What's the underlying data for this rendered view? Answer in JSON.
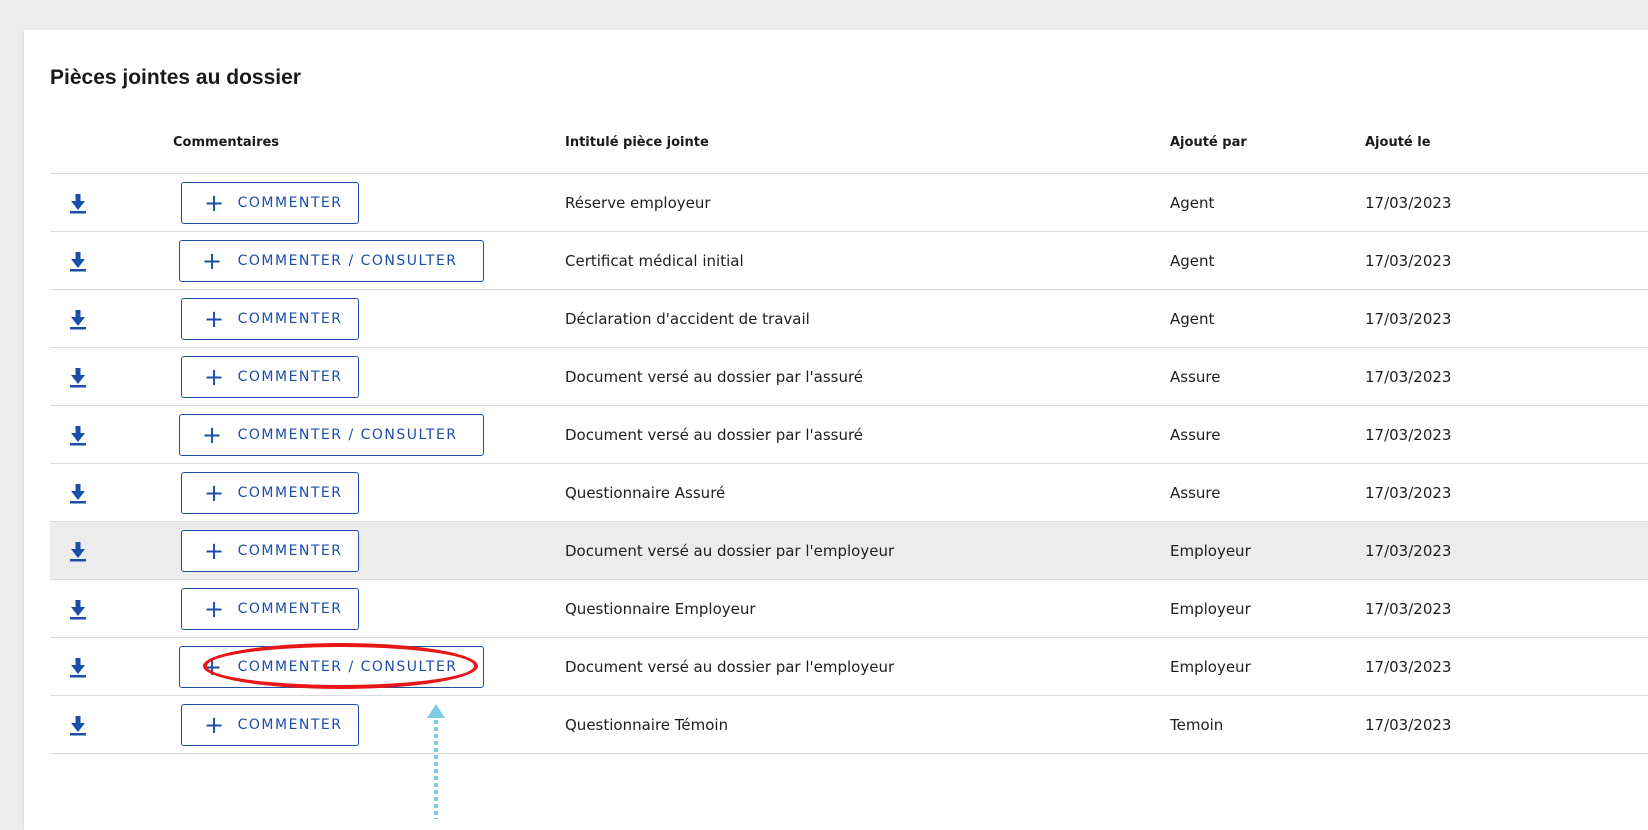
{
  "section": {
    "title": "Pièces jointes au dossier"
  },
  "table": {
    "headers": {
      "comments": "Commentaires",
      "attachment_title": "Intitulé pièce jointe",
      "added_by": "Ajouté par",
      "added_on": "Ajouté le"
    },
    "rows": [
      {
        "button": "COMMENTER",
        "title": "Réserve employeur",
        "added_by": "Agent",
        "date": "17/03/2023"
      },
      {
        "button": "COMMENTER / CONSULTER",
        "title": "Certificat médical initial",
        "added_by": "Agent",
        "date": "17/03/2023"
      },
      {
        "button": "COMMENTER",
        "title": "Déclaration d'accident de travail",
        "added_by": "Agent",
        "date": "17/03/2023"
      },
      {
        "button": "COMMENTER",
        "title": "Document versé au dossier par l'assuré",
        "added_by": "Assure",
        "date": "17/03/2023"
      },
      {
        "button": "COMMENTER / CONSULTER",
        "title": "Document versé au dossier par l'assuré",
        "added_by": "Assure",
        "date": "17/03/2023"
      },
      {
        "button": "COMMENTER",
        "title": "Questionnaire Assuré",
        "added_by": "Assure",
        "date": "17/03/2023"
      },
      {
        "button": "COMMENTER",
        "title": "Document versé au dossier par l'employeur",
        "added_by": "Employeur",
        "date": "17/03/2023",
        "highlighted": true
      },
      {
        "button": "COMMENTER",
        "title": "Questionnaire Employeur",
        "added_by": "Employeur",
        "date": "17/03/2023"
      },
      {
        "button": "COMMENTER / CONSULTER",
        "title": "Document versé au dossier par l'employeur",
        "added_by": "Employeur",
        "date": "17/03/2023"
      },
      {
        "button": "COMMENTER",
        "title": "Questionnaire Témoin",
        "added_by": "Temoin",
        "date": "17/03/2023"
      }
    ]
  },
  "icons": {
    "download": "download-icon",
    "plus": "plus-icon"
  },
  "colors": {
    "accent": "#1c4ea8",
    "annotation": "#e81616",
    "arrow": "#7ecbe8",
    "highlight_row": "#ececec"
  }
}
